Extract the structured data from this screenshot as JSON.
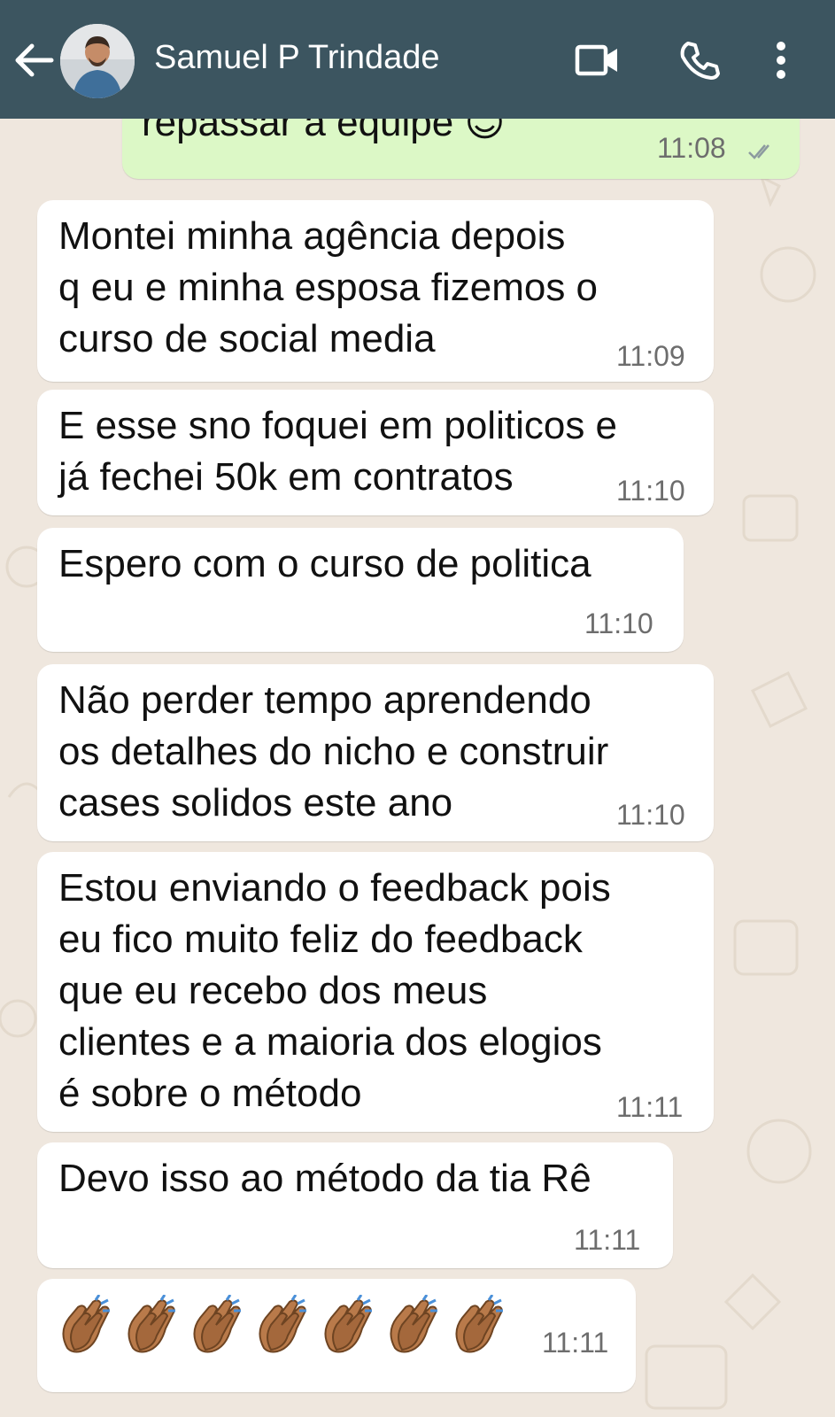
{
  "header": {
    "contact_name": "Samuel P Trindade",
    "icons": [
      "back-arrow-icon",
      "avatar",
      "video-call-icon",
      "phone-icon",
      "more-vert-icon"
    ],
    "colors": {
      "bar": "#3c5560",
      "text": "#ffffff"
    }
  },
  "messages": [
    {
      "direction": "outgoing",
      "text": "repassar a equipe 😊",
      "time": "11:08",
      "status": "read-double-check"
    },
    {
      "direction": "incoming",
      "text": "Montei minha agência depois\nq eu e minha esposa fizemos o\ncurso de social media",
      "time": "11:09"
    },
    {
      "direction": "incoming",
      "text": "E esse sno foquei em politicos e\njá fechei 50k em contratos",
      "time": "11:10"
    },
    {
      "direction": "incoming",
      "text": "Espero com o curso de politica",
      "time": "11:10"
    },
    {
      "direction": "incoming",
      "text": "Não perder tempo aprendendo\nos detalhes do nicho e construir\ncases solidos este ano",
      "time": "11:10"
    },
    {
      "direction": "incoming",
      "text": "Estou enviando o feedback pois\neu fico muito feliz do feedback\nque eu recebo dos meus\nclientes e a maioria dos elogios\né sobre o método",
      "time": "11:11"
    },
    {
      "direction": "incoming",
      "text": "Devo isso ao método da tia Rê",
      "time": "11:11"
    },
    {
      "direction": "incoming",
      "emoji": "clapping-hands x7",
      "time": "11:11"
    }
  ],
  "colors": {
    "wallpaper": "#efe7de",
    "incoming": "#ffffff",
    "outgoing": "#dcf8c6",
    "time": "#6d6d6d"
  }
}
